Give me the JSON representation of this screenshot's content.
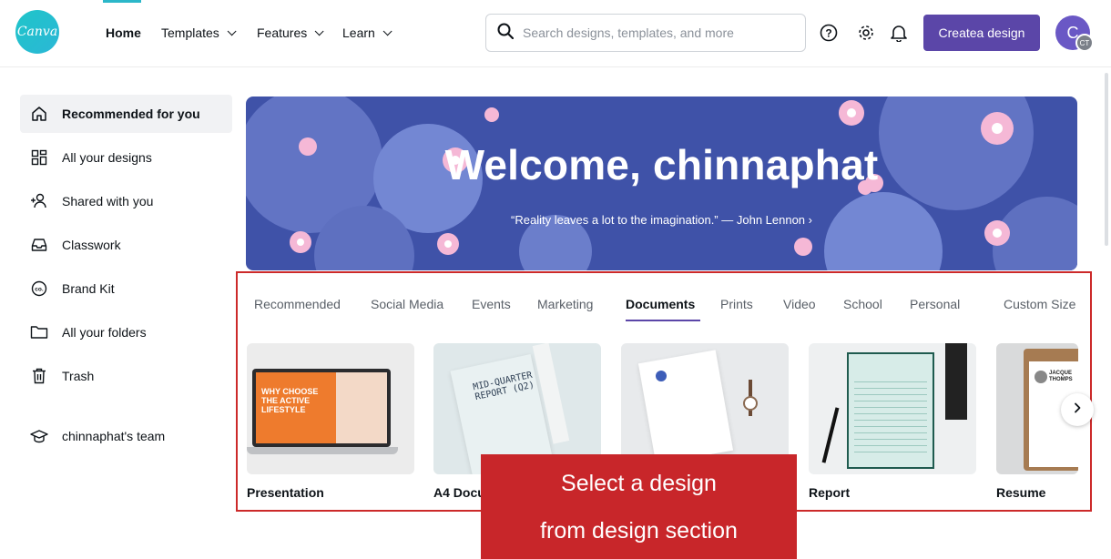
{
  "app": {
    "logo_text": "Canva"
  },
  "nav": {
    "home": "Home",
    "templates": "Templates",
    "features": "Features",
    "learn": "Learn"
  },
  "search": {
    "placeholder": "Search designs, templates, and more"
  },
  "header": {
    "create_label": "Createa design",
    "avatar_initial": "C",
    "avatar_sub": "CT"
  },
  "sidebar": {
    "items": [
      {
        "label": "Recommended for you",
        "icon": "home-icon"
      },
      {
        "label": "All your designs",
        "icon": "grid-icon"
      },
      {
        "label": "Shared with you",
        "icon": "shared-users-icon"
      },
      {
        "label": "Classwork",
        "icon": "inbox-icon"
      },
      {
        "label": "Brand Kit",
        "icon": "brand-kit-icon"
      },
      {
        "label": "All your folders",
        "icon": "folder-icon"
      },
      {
        "label": "Trash",
        "icon": "trash-icon"
      }
    ],
    "team": {
      "label": "chinnaphat's team",
      "icon": "graduation-cap-icon"
    }
  },
  "hero": {
    "title": "Welcome, chinnaphat",
    "quote": "“Reality leaves a lot to the imagination.” — John Lennon ›"
  },
  "tabs": [
    "Recommended",
    "Social Media",
    "Events",
    "Marketing",
    "Documents",
    "Prints",
    "Video",
    "School",
    "Personal",
    "Custom Size"
  ],
  "active_tab": "Documents",
  "cards": [
    {
      "label": "Presentation",
      "thumb_text": "WHY CHOOSE THE ACTIVE LIFESTYLE"
    },
    {
      "label": "A4 Docu",
      "thumb_text": "MID-QUARTER REPORT (Q2)"
    },
    {
      "label": "",
      "thumb_text": ""
    },
    {
      "label": "Report",
      "thumb_text": ""
    },
    {
      "label": "Resume",
      "thumb_text": "JACQUE THOMPS"
    }
  ],
  "callout": {
    "line1": "Select a design",
    "line2": "from design section"
  },
  "colors": {
    "brand_purple": "#5b46a8",
    "hero_blue": "#3f52a8",
    "callout_red": "#c8262a",
    "canva_teal": "#1fc5c9"
  }
}
